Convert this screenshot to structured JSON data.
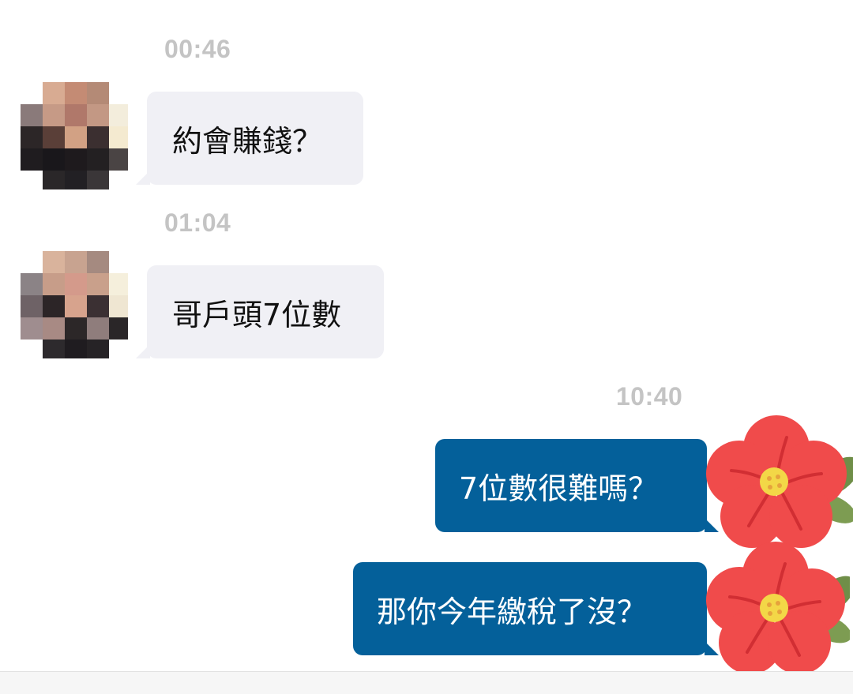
{
  "messages": [
    {
      "time": "00:46",
      "direction": "incoming",
      "text": "約會賺錢？"
    },
    {
      "time": "01:04",
      "direction": "incoming",
      "text": "哥戶頭7位數"
    },
    {
      "time": "10:40",
      "direction": "outgoing",
      "text": "7位數很難嗎？"
    },
    {
      "direction": "outgoing",
      "text": "那你今年繳稅了沒？"
    }
  ],
  "colors": {
    "incoming_bubble": "#f0f0f5",
    "outgoing_bubble": "#04609a",
    "timestamp": "#c4c4c4",
    "background": "#ffffff"
  },
  "icons": {
    "sender_avatar": "pixelated-avatar",
    "reaction_sticker": "red-flower-sticker"
  }
}
